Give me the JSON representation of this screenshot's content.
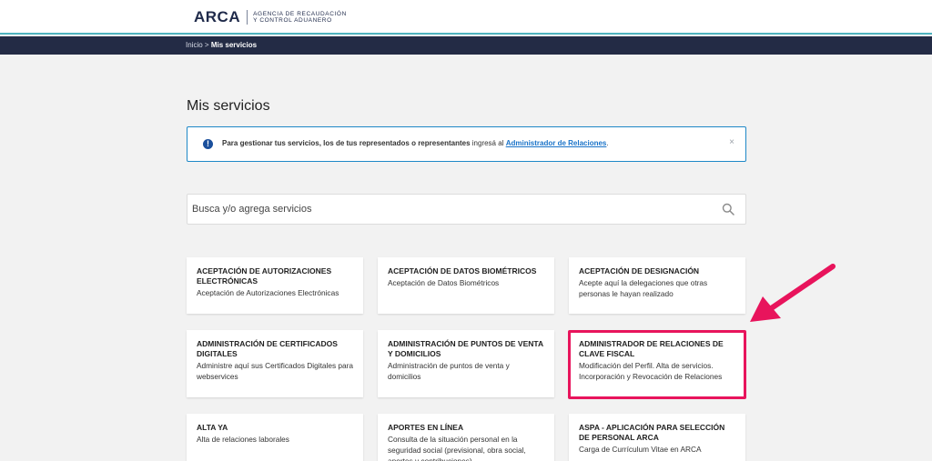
{
  "header": {
    "logo_word": "ARCA",
    "logo_sub_line1": "AGENCIA DE RECAUDACIÓN",
    "logo_sub_line2": "Y CONTROL ADUANERO"
  },
  "breadcrumb": {
    "home": "Inicio",
    "separator": " > ",
    "current": "Mis servicios"
  },
  "page": {
    "title": "Mis servicios"
  },
  "alert": {
    "text_bold": "Para gestionar tus servicios, los de tus representados o representantes",
    "text_normal": " ingresá al ",
    "link": "Administrador de Relaciones",
    "suffix": ".",
    "close": "×"
  },
  "search": {
    "placeholder": "Busca y/o agrega servicios"
  },
  "cards": [
    {
      "title": "ACEPTACIÓN DE AUTORIZACIONES ELECTRÓNICAS",
      "desc": "Aceptación de Autorizaciones Electrónicas"
    },
    {
      "title": "ACEPTACIÓN DE DATOS BIOMÉTRICOS",
      "desc": "Aceptación de Datos Biométricos"
    },
    {
      "title": "ACEPTACIÓN DE DESIGNACIÓN",
      "desc": "Acepte aquí la delegaciones que otras personas le hayan realizado"
    },
    {
      "title": "ADMINISTRACIÓN DE CERTIFICADOS DIGITALES",
      "desc": "Administre aquí sus Certificados Digitales para webservices"
    },
    {
      "title": "ADMINISTRACIÓN DE PUNTOS DE VENTA Y DOMICILIOS",
      "desc": "Administración de puntos de venta y domicilios"
    },
    {
      "title": "ADMINISTRADOR DE RELACIONES DE CLAVE FISCAL",
      "desc": "Modificación del Perfil. Alta de servicios. Incorporación y Revocación de Relaciones"
    },
    {
      "title": "ALTA YA",
      "desc": "Alta de relaciones laborales"
    },
    {
      "title": "APORTES EN LÍNEA",
      "desc": "Consulta de la situación personal en la seguridad social (previsional, obra social, aportes y contribuciones)"
    },
    {
      "title": "ASPA - APLICACIÓN PARA SELECCIÓN DE PERSONAL ARCA",
      "desc": "Carga de Currículum Vitae en ARCA"
    }
  ],
  "colors": {
    "navbar": "#232b45",
    "accent_line": "#4fb3bf",
    "alert_border": "#1e88c7",
    "link": "#1a73c8",
    "highlight": "#e8145c"
  }
}
